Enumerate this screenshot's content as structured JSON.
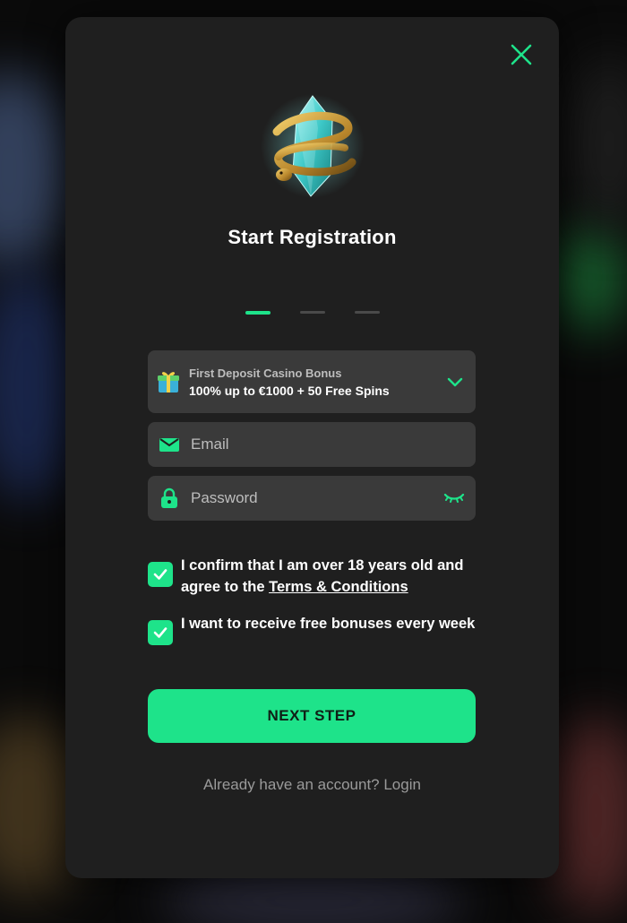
{
  "modal": {
    "title": "Start Registration",
    "steps": {
      "current": 1,
      "total": 3
    }
  },
  "bonus": {
    "label": "First Deposit Casino Bonus",
    "value": "100% up to €1000 + 50 Free Spins",
    "icon": "gift-icon"
  },
  "email": {
    "placeholder": "Email",
    "value": "",
    "icon": "envelope-icon"
  },
  "password": {
    "placeholder": "Password",
    "value": "",
    "icon": "lock-icon",
    "toggle_icon": "eye-closed-icon"
  },
  "age_confirm": {
    "checked": true,
    "text_before": "I confirm that I am over 18 years old and agree to the ",
    "link_text": "Terms & Conditions"
  },
  "newsletter": {
    "checked": true,
    "text": "I want to receive free bonuses every week"
  },
  "next_button": {
    "label": "NEXT STEP"
  },
  "login_link": {
    "label": "Already have an account? Login"
  },
  "colors": {
    "accent": "#1ee38a",
    "modal_bg": "#1f1f1f",
    "field_bg": "#3a3a3a"
  }
}
